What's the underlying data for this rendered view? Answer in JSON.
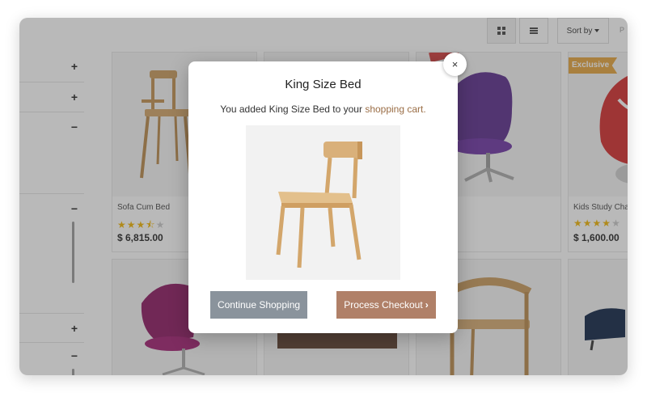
{
  "toolbar": {
    "grid_icon": "grid-icon",
    "list_icon": "list-icon",
    "sort_label": "Sort by",
    "per_page_label": "P"
  },
  "sidebar": {
    "toggles": [
      "+",
      "+",
      "−",
      "−",
      "+",
      "−"
    ]
  },
  "products": [
    {
      "name": "Sofa Cum Bed",
      "rating": 3.5,
      "stars": [
        "★",
        "★",
        "★",
        "⯪",
        "★"
      ],
      "price": "$ 6,815.00",
      "badge": ""
    },
    {
      "name": "",
      "rating": null,
      "stars": [],
      "price": "",
      "badge": ""
    },
    {
      "name": "ed",
      "rating": 4.5,
      "stars": [
        "★",
        "★",
        "⯪"
      ],
      "price": "00",
      "badge": ""
    },
    {
      "name": "Kids Study Cha",
      "rating": 4,
      "stars": [
        "★",
        "★",
        "★",
        "★",
        "★"
      ],
      "price": "$ 1,600.00",
      "badge": "Exclusive"
    }
  ],
  "modal": {
    "title": "King Size Bed",
    "message_prefix": "You added King Size Bed to your ",
    "message_link": "shopping cart.",
    "continue_label": "Continue Shopping",
    "checkout_label": "Process Checkout",
    "close_label": "×"
  },
  "colors": {
    "accent_link": "#9a6d45",
    "checkout_bg": "#b08068",
    "continue_bg": "#8a939c",
    "star": "#f0b400",
    "badge": "#e6a43b"
  }
}
